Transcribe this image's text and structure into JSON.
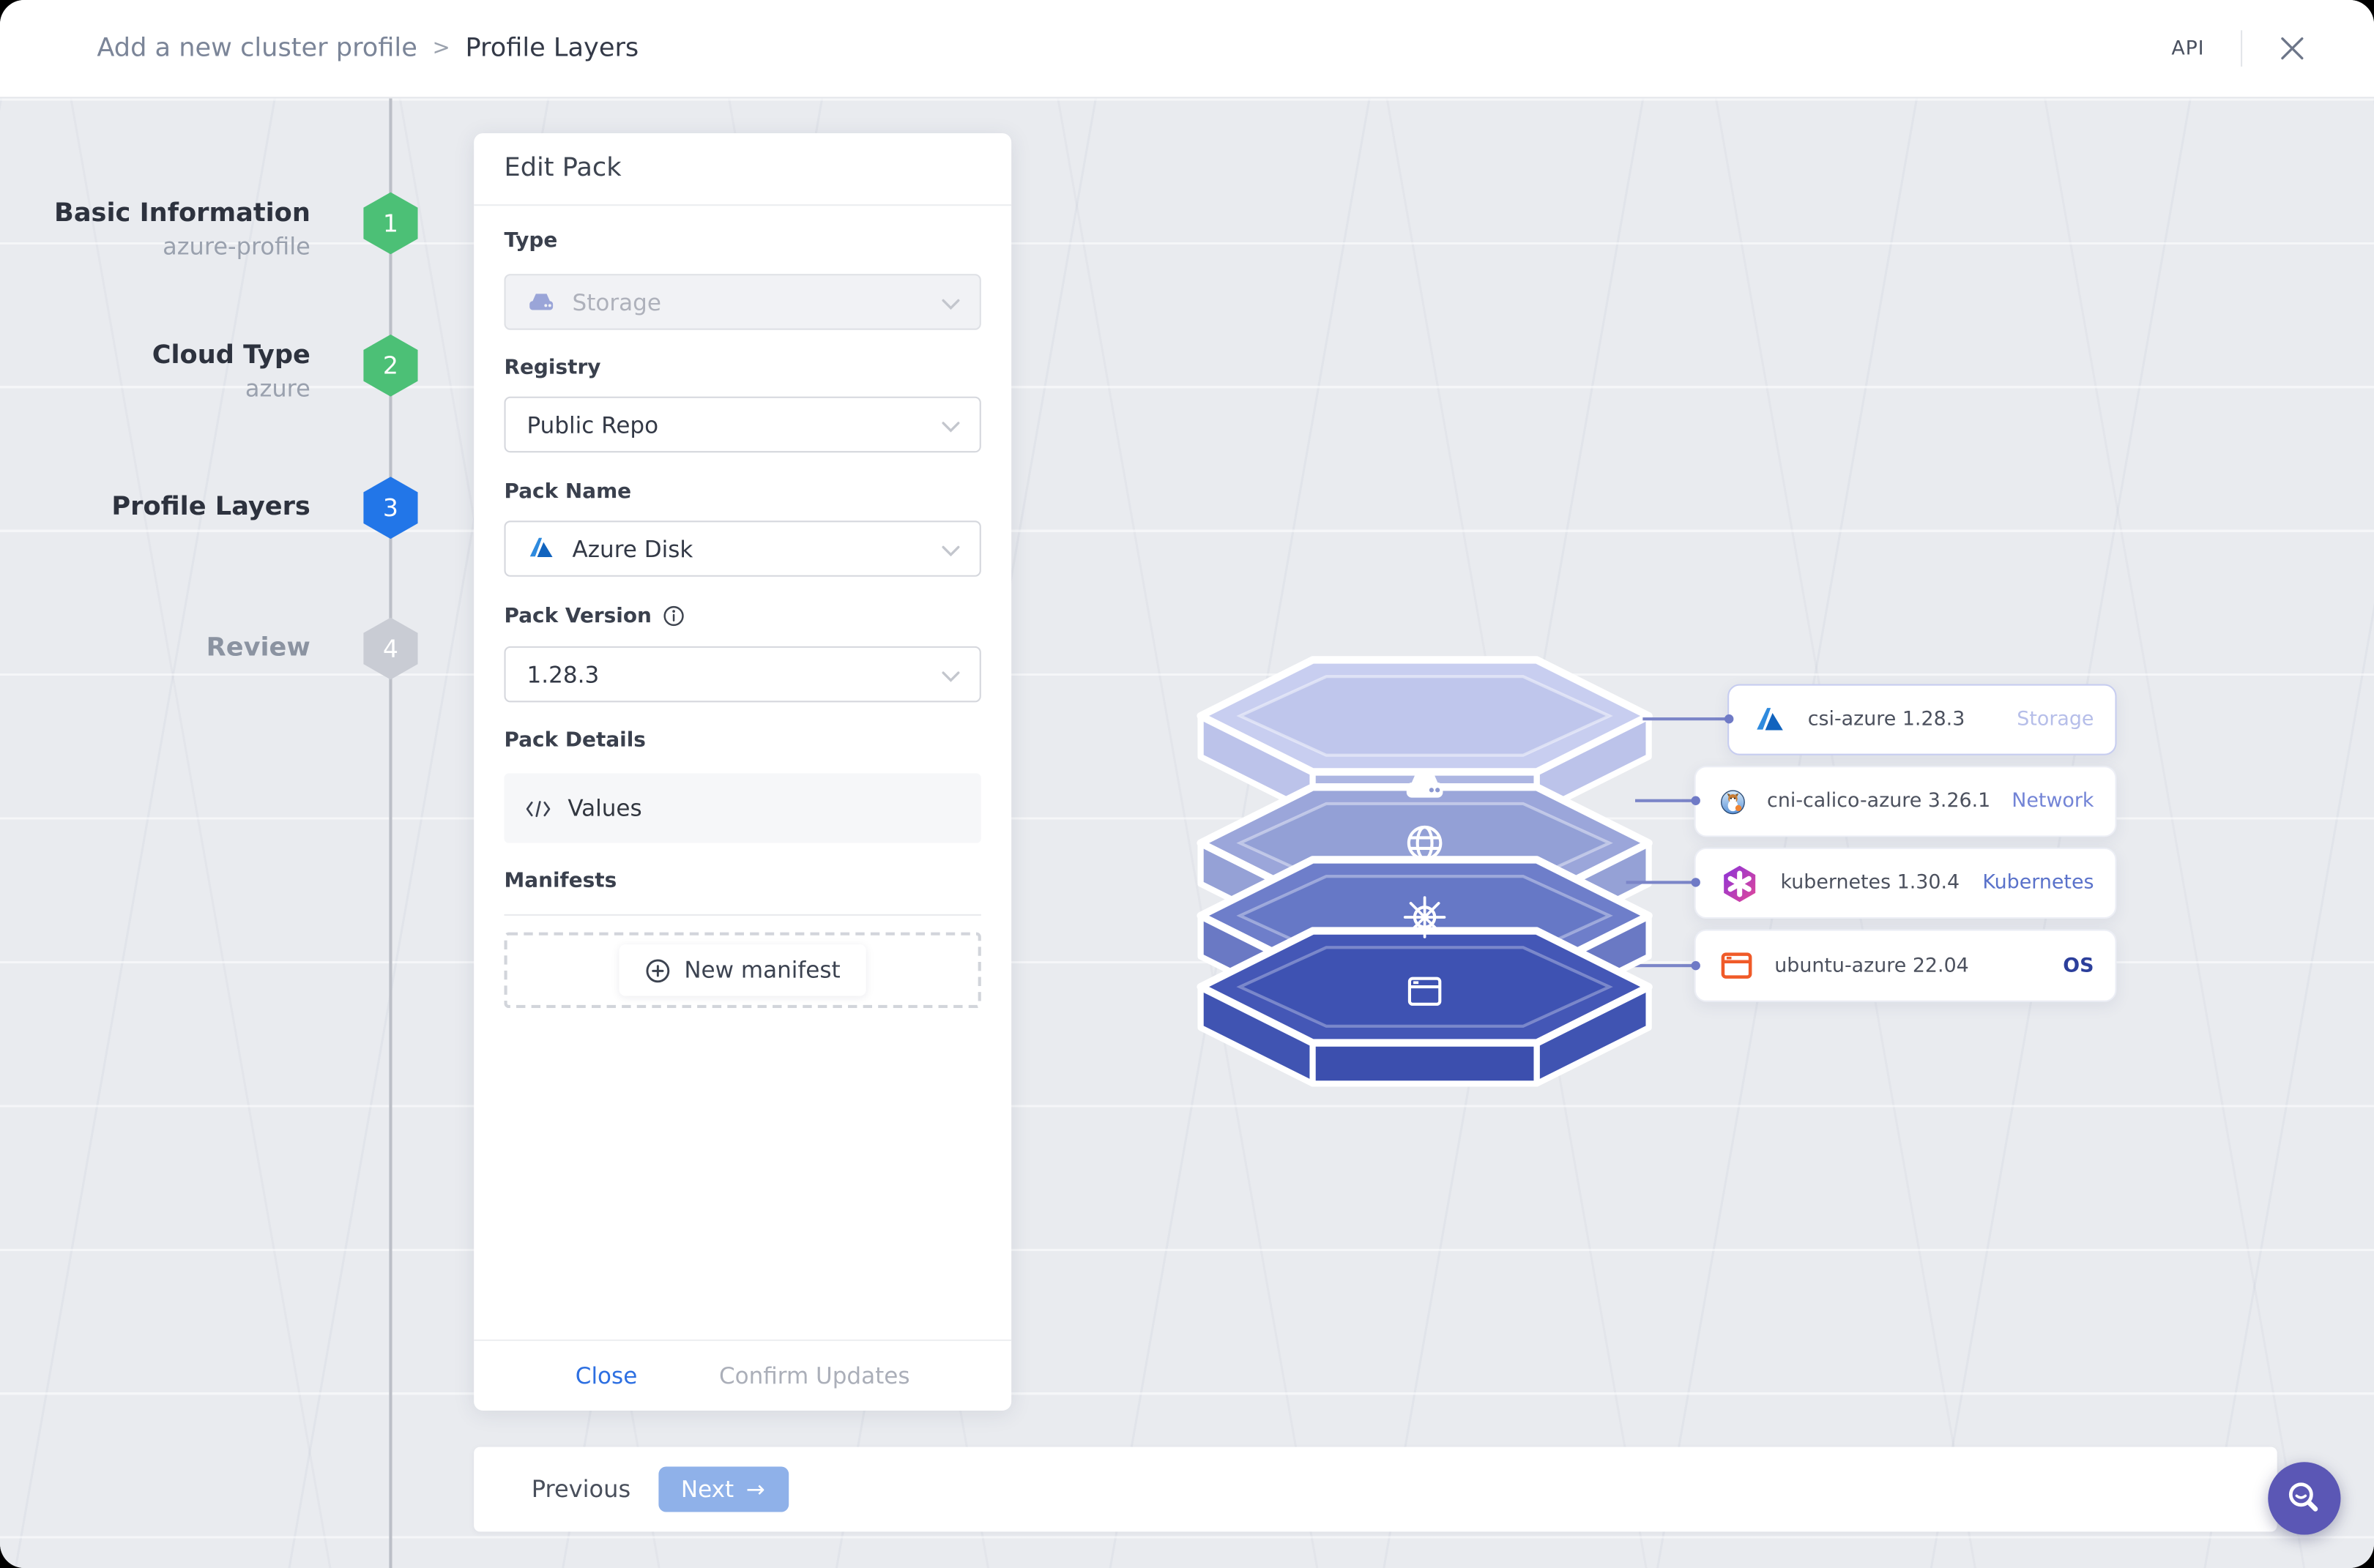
{
  "header": {
    "breadcrumb_parent": "Add a new cluster profile",
    "breadcrumb_separator": ">",
    "breadcrumb_current": "Profile Layers",
    "api_label": "API"
  },
  "stepper": {
    "steps": [
      {
        "number": "1",
        "title": "Basic Information",
        "subtitle": "azure-profile",
        "state": "done"
      },
      {
        "number": "2",
        "title": "Cloud Type",
        "subtitle": "azure",
        "state": "done"
      },
      {
        "number": "3",
        "title": "Profile Layers",
        "subtitle": "",
        "state": "active"
      },
      {
        "number": "4",
        "title": "Review",
        "subtitle": "",
        "state": "pending"
      }
    ]
  },
  "edit_pack": {
    "title": "Edit Pack",
    "fields": {
      "type": {
        "label": "Type",
        "value": "Storage",
        "disabled": true
      },
      "registry": {
        "label": "Registry",
        "value": "Public Repo"
      },
      "pack_name": {
        "label": "Pack Name",
        "value": "Azure Disk"
      },
      "pack_version": {
        "label": "Pack Version",
        "value": "1.28.3"
      }
    },
    "pack_details": {
      "label": "Pack Details",
      "values_label": "Values"
    },
    "manifests": {
      "label": "Manifests",
      "new_manifest_label": "New manifest"
    },
    "footer": {
      "close_label": "Close",
      "confirm_label": "Confirm Updates"
    }
  },
  "layers": [
    {
      "name": "csi-azure 1.28.3",
      "category": "Storage",
      "icon": "azure-icon",
      "selected": true
    },
    {
      "name": "cni-calico-azure 3.26.1",
      "category": "Network",
      "icon": "calico-icon",
      "selected": false
    },
    {
      "name": "kubernetes 1.30.4",
      "category": "Kubernetes",
      "icon": "kubernetes-icon",
      "selected": false
    },
    {
      "name": "ubuntu-azure 22.04",
      "category": "OS",
      "icon": "ubuntu-icon",
      "selected": false
    }
  ],
  "footer_bar": {
    "previous_label": "Previous",
    "next_label": "Next"
  },
  "colors": {
    "step_done_green": "#4cc076",
    "step_active_blue": "#2276e8",
    "step_pending_gray": "#c9ccd4",
    "next_button_blue": "#8fb1e9",
    "close_link_blue": "#2d6fe1",
    "beacon_purple": "#5b57b5",
    "category_storage": "#b6bee9",
    "category_network": "#7384d6",
    "category_kubernetes": "#5a72ca",
    "category_os": "#2c3f9b",
    "ubuntu_orange": "#f05a28",
    "stack_layer_top_1": "#c8cef0",
    "stack_layer_top_2": "#9ba6da",
    "stack_layer_top_3": "#6e7eca",
    "stack_layer_top_4": "#4457b6"
  }
}
